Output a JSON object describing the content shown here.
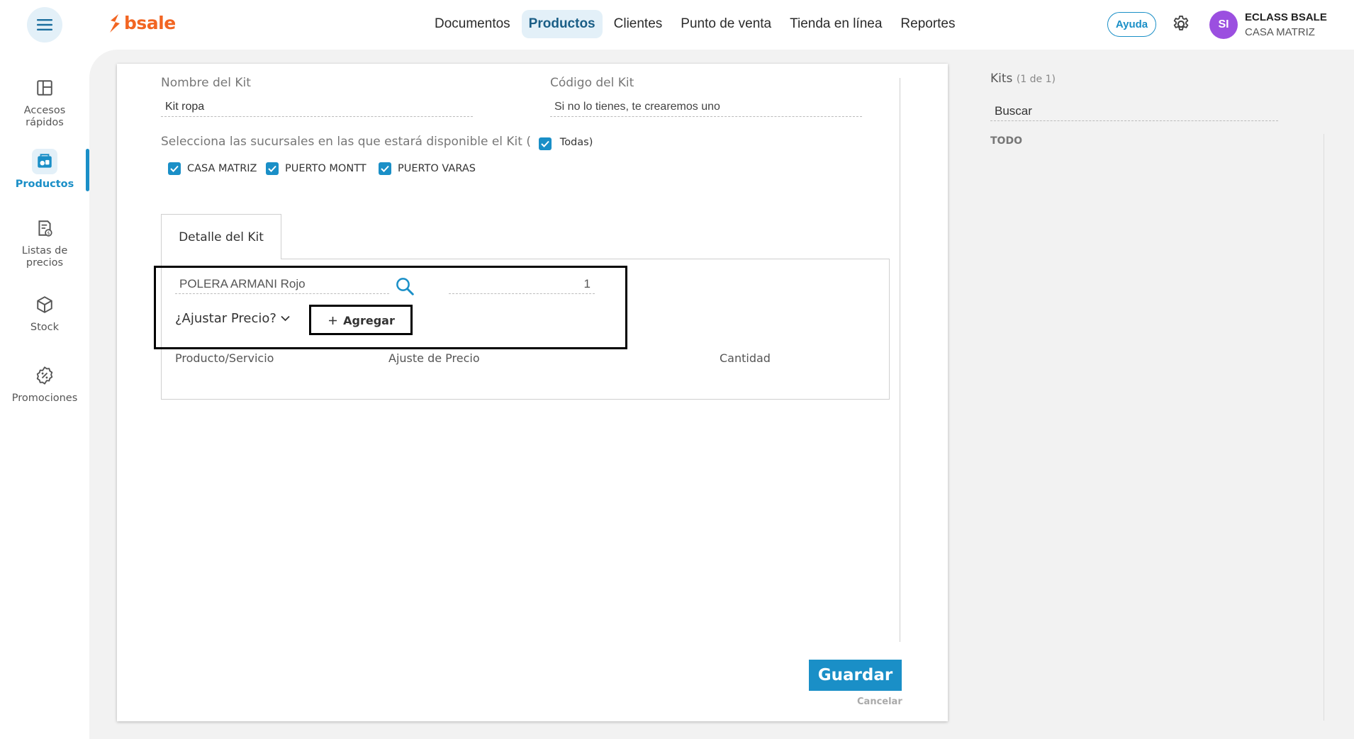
{
  "brand": {
    "name": "bsale",
    "color": "#f26522",
    "accent": "#1a8fc7"
  },
  "nav": {
    "items": [
      "Documentos",
      "Productos",
      "Clientes",
      "Punto de venta",
      "Tienda en línea",
      "Reportes"
    ],
    "active": "Productos"
  },
  "header": {
    "help_label": "Ayuda",
    "avatar_initials": "SI",
    "user_name": "ECLASS BSALE",
    "user_branch": "CASA MATRIZ"
  },
  "sidebar": {
    "items": [
      {
        "label_line1": "Accesos",
        "label_line2": "rápidos",
        "icon": "layout-icon"
      },
      {
        "label_line1": "Productos",
        "label_line2": "",
        "icon": "products-icon",
        "active": true
      },
      {
        "label_line1": "Listas de",
        "label_line2": "precios",
        "icon": "price-list-icon"
      },
      {
        "label_line1": "Stock",
        "label_line2": "",
        "icon": "cube-icon"
      },
      {
        "label_line1": "Promociones",
        "label_line2": "",
        "icon": "discount-badge-icon"
      }
    ]
  },
  "form": {
    "kit_name_label": "Nombre del Kit",
    "kit_name_value": "Kit ropa",
    "kit_code_label": "Código del Kit",
    "kit_code_placeholder": "Si no lo tienes, te crearemos uno",
    "branches_text": "Selecciona las sucursales en las que estará disponible el Kit (",
    "all_label": "Todas",
    "all_close": ")",
    "branches": [
      {
        "label": "CASA MATRIZ",
        "checked": true
      },
      {
        "label": "PUERTO MONTT",
        "checked": true
      },
      {
        "label": "PUERTO VARAS",
        "checked": true
      }
    ]
  },
  "detail": {
    "tab_label": "Detalle del Kit",
    "product_search_value": "POLERA ARMANI Rojo",
    "quantity_value": "1",
    "adjust_price_label": "¿Ajustar Precio?",
    "add_label": "Agregar",
    "columns": [
      "Producto/Servicio",
      "Ajuste de Precio",
      "Cantidad"
    ]
  },
  "actions": {
    "save_label": "Guardar",
    "cancel_label": "Cancelar"
  },
  "kits_panel": {
    "title": "Kits",
    "count": "(1 de 1)",
    "search_placeholder": "Buscar",
    "filter_label": "TODO"
  }
}
